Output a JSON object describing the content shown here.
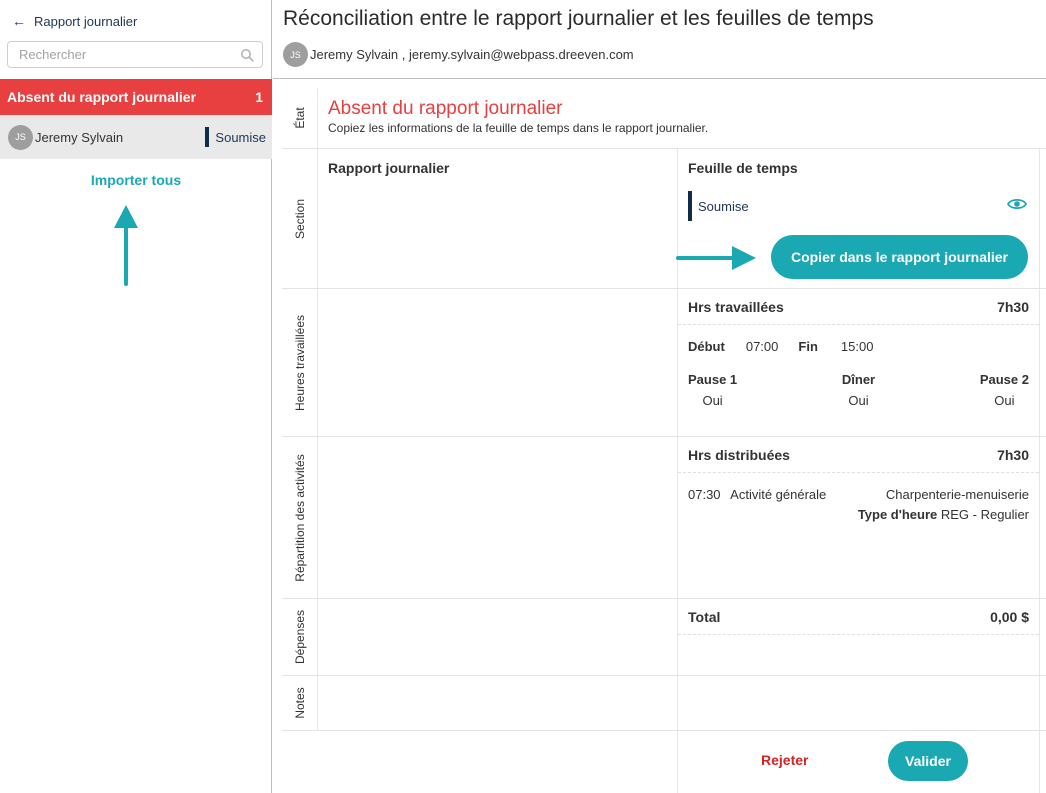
{
  "sidebar": {
    "back_label": "Rapport journalier",
    "search_placeholder": "Rechercher",
    "group": {
      "title": "Absent du rapport journalier",
      "count": "1"
    },
    "items": [
      {
        "initials": "JS",
        "name": "Jeremy Sylvain",
        "status": "Soumise"
      }
    ],
    "import_all_label": "Importer tous"
  },
  "header": {
    "title": "Réconciliation entre le rapport journalier et les feuilles de temps",
    "user_initials": "JS",
    "user_line": "Jeremy Sylvain , jeremy.sylvain@webpass.dreeven.com"
  },
  "rows": {
    "state": {
      "label": "État",
      "title": "Absent du rapport journalier",
      "description": "Copiez les informations de la feuille de temps dans le rapport journalier."
    },
    "section": {
      "label": "Section",
      "rapport_title": "Rapport journalier",
      "feuille_title": "Feuille de temps",
      "status": "Soumise",
      "copy_button": "Copier dans le rapport journalier"
    },
    "hours": {
      "label": "Heures travaillées",
      "title": "Hrs travaillées",
      "total": "7h30",
      "start_label": "Début",
      "start": "07:00",
      "end_label": "Fin",
      "end": "15:00",
      "pauses": [
        {
          "label": "Pause 1",
          "value": "Oui"
        },
        {
          "label": "Dîner",
          "value": "Oui"
        },
        {
          "label": "Pause 2",
          "value": "Oui"
        }
      ]
    },
    "activities": {
      "label": "Répartition des activités",
      "title": "Hrs distribuées",
      "total": "7h30",
      "time": "07:30",
      "activity": "Activité générale",
      "trade": "Charpenterie-menuiserie",
      "hour_type_label": "Type d'heure",
      "hour_type": "REG - Regulier"
    },
    "expenses": {
      "label": "Dépenses",
      "title": "Total",
      "total": "0,00 $"
    },
    "notes": {
      "label": "Notes"
    }
  },
  "footer": {
    "reject_label": "Rejeter",
    "validate_label": "Valider"
  },
  "colors": {
    "accent": "#1aa8b3",
    "danger": "#e84040",
    "navy": "#0f2d4a"
  }
}
